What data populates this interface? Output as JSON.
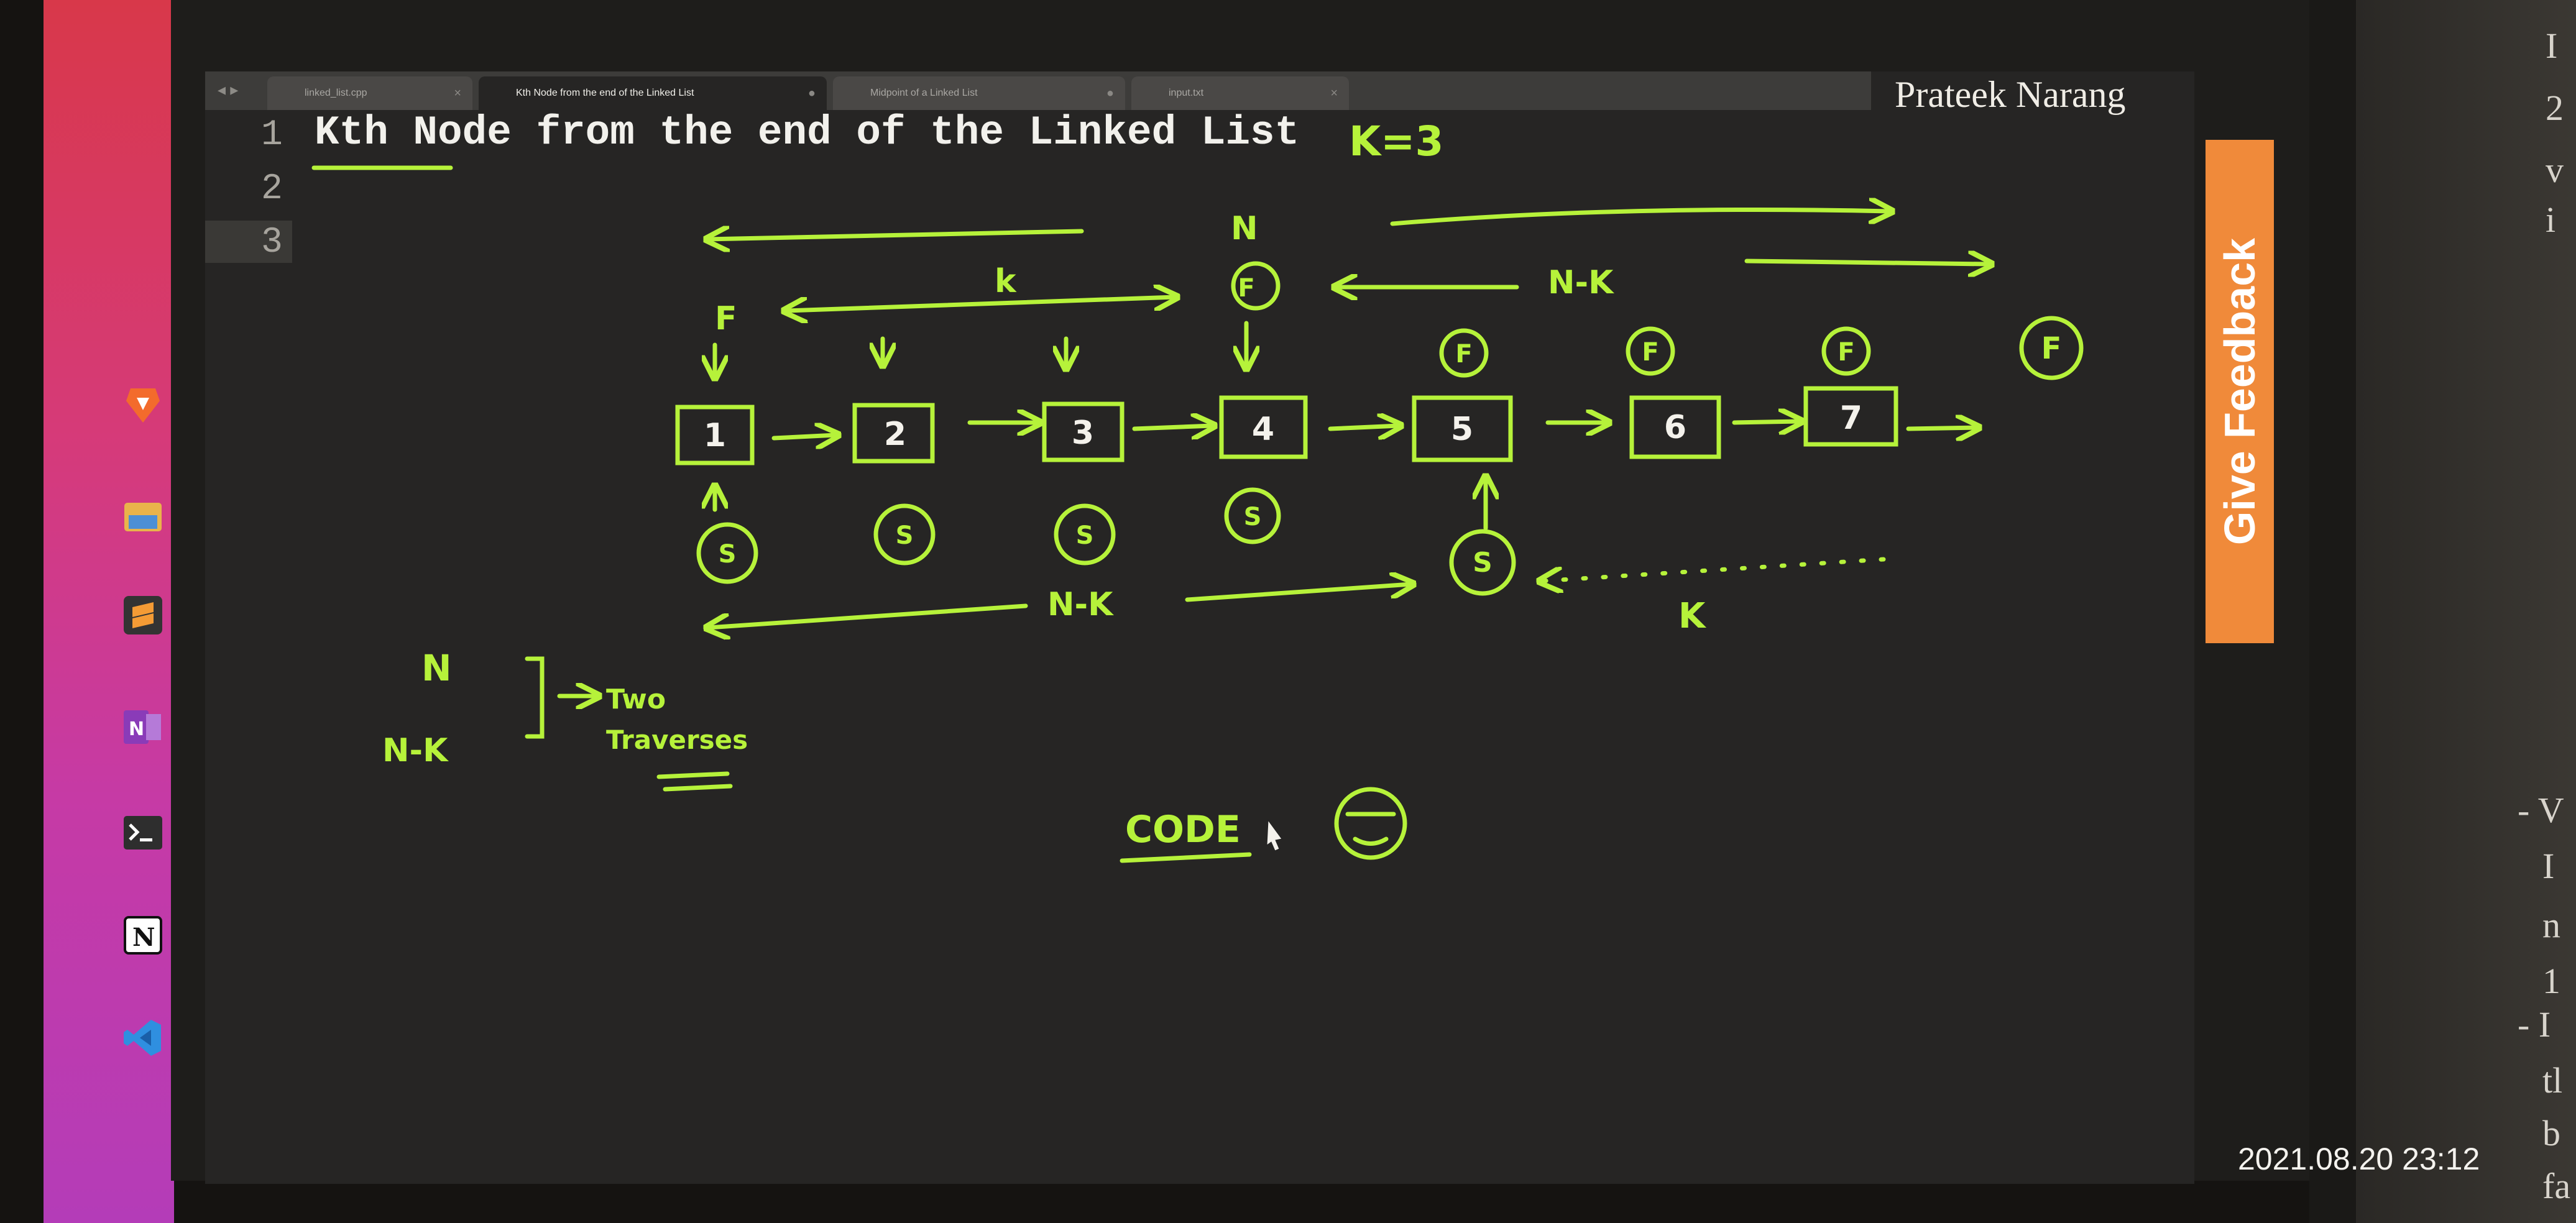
{
  "tabs": [
    {
      "label": "linked_list.cpp"
    },
    {
      "label": "Kth Node from the end of the Linked List"
    },
    {
      "label": "Midpoint of a Linked List"
    },
    {
      "label": "input.txt"
    }
  ],
  "editor": {
    "line_numbers": [
      "1",
      "2",
      "3"
    ],
    "line1": "Kth Node from the end of the Linked List"
  },
  "author": "Prateek Narang",
  "feedback_label": "Give Feedback",
  "timestamp": "2021.08.20 23:12",
  "dock_icons": [
    "brave-icon",
    "files-icon",
    "sublime-icon",
    "onenote-icon",
    "terminal-icon",
    "notion-icon",
    "vscode-icon"
  ],
  "sidebar_fragments": [
    "I",
    "2",
    "v",
    "i",
    "- V",
    "I",
    "n",
    "1",
    "- I",
    "tl",
    "b",
    "fa"
  ],
  "annotations": {
    "k_eq": "K=3",
    "N_top": "N",
    "k_label": "k",
    "nk_top": "N-K",
    "F": "F",
    "fast_circle": "F",
    "slow_circle": "S",
    "nodes": [
      "1",
      "2",
      "3",
      "4",
      "5",
      "6",
      "7"
    ],
    "nk_bottom": "N-K",
    "k_bottom": "K",
    "N_left": "N",
    "NK_left": "N-K",
    "two": "Two",
    "traverses": "Traverses",
    "code": "CODE"
  },
  "colors": {
    "ink": "#b6f23a",
    "accent": "#f08a3a"
  }
}
